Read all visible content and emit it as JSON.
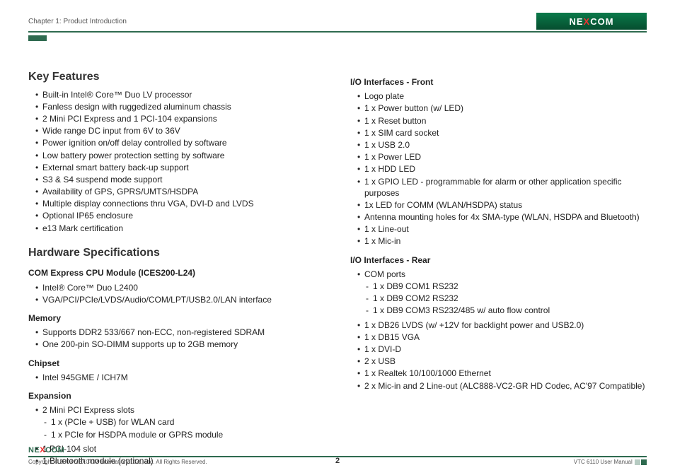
{
  "header": {
    "chapter": "Chapter 1: Product Introduction",
    "logo_text_pre": "NE",
    "logo_text_x": "X",
    "logo_text_post": "COM"
  },
  "col1": {
    "h2_features": "Key Features",
    "features": [
      "Built-in Intel® Core™ Duo LV processor",
      "Fanless design with ruggedized aluminum chassis",
      "2 Mini PCI Express and 1 PCI-104 expansions",
      "Wide range DC input from 6V to 36V",
      "Power ignition on/off delay controlled by software",
      "Low battery power protection setting by software",
      "External smart battery back-up support",
      "S3 & S4 suspend mode support",
      "Availability of GPS, GPRS/UMTS/HSDPA",
      "Multiple display connections thru VGA, DVI-D and LVDS",
      "Optional IP65 enclosure",
      "e13 Mark certification"
    ],
    "h2_hw": "Hardware Specifications",
    "h3_com": "COM Express CPU Module (ICES200-L24)",
    "com_items": [
      "Intel® Core™ Duo L2400",
      "VGA/PCI/PCIe/LVDS/Audio/COM/LPT/USB2.0/LAN interface"
    ],
    "h3_mem": "Memory",
    "mem_items": [
      "Supports DDR2 533/667 non-ECC, non-registered SDRAM",
      "One 200-pin SO-DIMM supports up to 2GB memory"
    ],
    "h3_chip": "Chipset",
    "chip_items": [
      "Intel 945GME / ICH7M"
    ],
    "h3_exp": "Expansion",
    "exp_items": [
      "2 Mini PCI Express slots",
      "1 PCI-104 slot",
      "1 Bluetooth module (optional)"
    ],
    "exp_sub": [
      "1 x (PCIe + USB) for WLAN card",
      "1 x PCIe for HSDPA module or GPRS module"
    ]
  },
  "col2": {
    "h3_front": "I/O Interfaces - Front",
    "front_items": [
      "Logo plate",
      "1 x Power button (w/ LED)",
      "1 x Reset button",
      "1 x SIM card socket",
      "1 x USB 2.0",
      "1 x Power LED",
      "1 x HDD LED",
      "1 x GPIO LED - programmable for alarm or other application specific purposes",
      "1x LED for COMM (WLAN/HSDPA) status",
      "Antenna mounting holes for 4x SMA-type (WLAN, HSDPA and Bluetooth)",
      "1 x Line-out",
      "1 x Mic-in"
    ],
    "h3_rear": "I/O Interfaces - Rear",
    "rear_items": [
      "COM ports",
      "1 x DB26 LVDS (w/ +12V for backlight power and USB2.0)",
      "1 x DB15 VGA",
      "1 x DVI-D",
      "2 x USB",
      "1 x Realtek 10/100/1000 Ethernet",
      "2 x Mic-in and 2 Line-out (ALC888-VC2-GR HD Codec, AC'97 Compatible)"
    ],
    "rear_sub": [
      "1 x DB9 COM1 RS232",
      "1 x DB9 COM2 RS232",
      "1 x DB9 COM3 RS232/485 w/ auto flow control"
    ]
  },
  "footer": {
    "logo_pre": "NE",
    "logo_x": "X",
    "logo_post": "COM",
    "copyright": "Copyright © 2009 NEXCOM International Co., Ltd. All Rights Reserved.",
    "page": "2",
    "manual": "VTC 6110 User Manual"
  }
}
